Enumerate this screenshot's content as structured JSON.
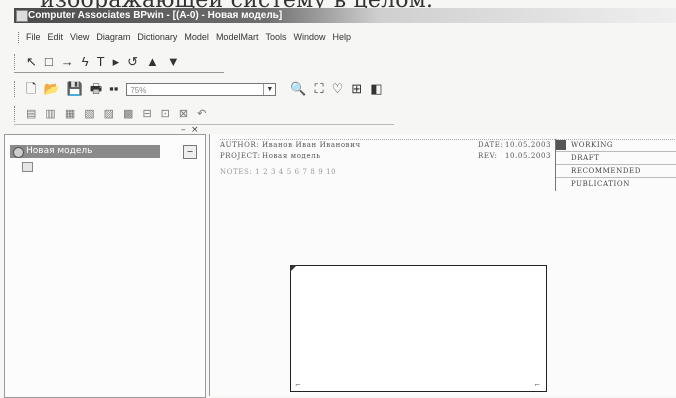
{
  "caption": "изображающей систему в целом.",
  "window": {
    "title": "Computer Associates BPwin - [(A-0) - Новая модель]"
  },
  "menu": {
    "items": [
      "File",
      "Edit",
      "View",
      "Diagram",
      "Dictionary",
      "Model",
      "ModelMart",
      "Tools",
      "Window",
      "Help"
    ]
  },
  "toolbar1": {
    "icons": [
      "pointer-icon",
      "box-icon",
      "arrow-icon",
      "squiggle-icon",
      "text-icon",
      "triangle-right-icon",
      "undo-circle-icon",
      "up-icon",
      "down-icon"
    ],
    "glyphs": [
      "↖",
      "□",
      "→",
      "ϟ",
      "T",
      "▸",
      "↺",
      "▲",
      "▼"
    ]
  },
  "toolbar2": {
    "combo_value": "75%",
    "glyphs_left": [
      "🗋",
      "📂",
      "💾",
      "🖶",
      "▪▪"
    ],
    "glyphs_right": [
      "🔍",
      "⛶",
      "♡",
      "⊞",
      "◧"
    ]
  },
  "toolbar3": {
    "glyphs": [
      "▤",
      "▥",
      "▦",
      "▧",
      "▨",
      "▩",
      "⊟",
      "⊡",
      "⊠",
      "↶"
    ]
  },
  "model_tree": {
    "root_label": "Новая модель"
  },
  "diagram_frame": {
    "author_label": "AUTHOR:",
    "author_value": "Иванов Иван Иванович",
    "project_label": "PROJECT:",
    "project_value": "Новая модель",
    "date_label": "DATE:",
    "date_value": "10.05.2003",
    "rev_label": "REV:",
    "rev_value": "10.05.2003",
    "notes": "NOTES: 1 2 3 4 5 6 7 8 9 10",
    "statuses": [
      "WORKING",
      "DRAFT",
      "RECOMMENDED",
      "PUBLICATION"
    ]
  }
}
